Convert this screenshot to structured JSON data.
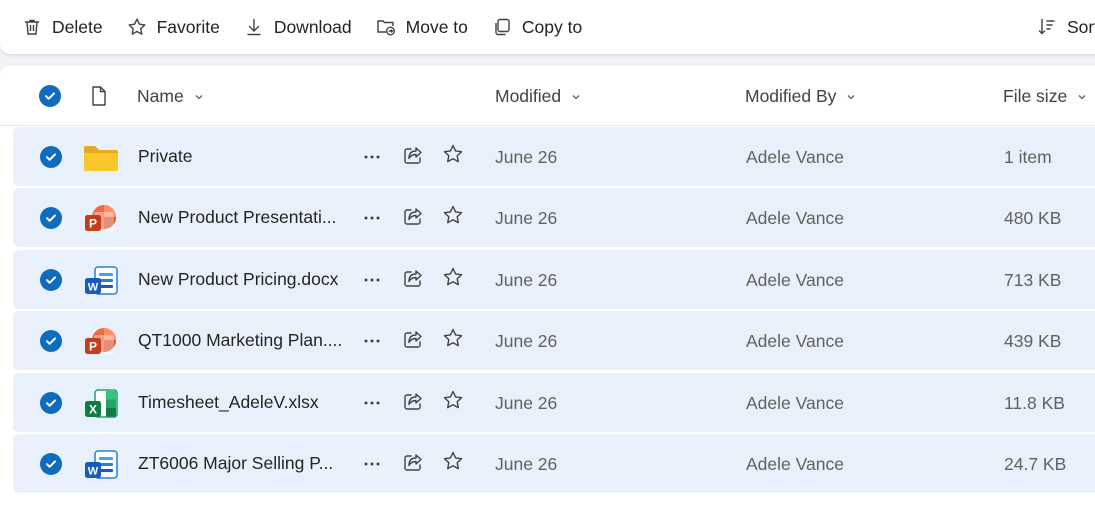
{
  "toolbar": {
    "delete_label": "Delete",
    "favorite_label": "Favorite",
    "download_label": "Download",
    "move_label": "Move to",
    "copy_label": "Copy to",
    "sort_label": "Sort"
  },
  "columns": {
    "name": "Name",
    "modified": "Modified",
    "modified_by": "Modified By",
    "file_size": "File size"
  },
  "files": [
    {
      "name": "Private",
      "type": "folder",
      "modified": "June 26",
      "modified_by": "Adele Vance",
      "size": "1 item"
    },
    {
      "name": "New Product Presentati...",
      "type": "powerpoint",
      "modified": "June 26",
      "modified_by": "Adele Vance",
      "size": "480 KB"
    },
    {
      "name": "New Product Pricing.docx",
      "type": "word",
      "modified": "June 26",
      "modified_by": "Adele Vance",
      "size": "713 KB"
    },
    {
      "name": "QT1000 Marketing Plan....",
      "type": "powerpoint",
      "modified": "June 26",
      "modified_by": "Adele Vance",
      "size": "439 KB"
    },
    {
      "name": "Timesheet_AdeleV.xlsx",
      "type": "excel",
      "modified": "June 26",
      "modified_by": "Adele Vance",
      "size": "11.8 KB"
    },
    {
      "name": "ZT6006 Major Selling P...",
      "type": "word",
      "modified": "June 26",
      "modified_by": "Adele Vance",
      "size": "24.7 KB"
    }
  ],
  "colors": {
    "accent": "#0f6cbd",
    "row_selected": "#e8f1fb",
    "folder": "#f7c72c",
    "powerpoint": "#c43e1c",
    "word": "#185abd",
    "excel": "#107c41"
  }
}
